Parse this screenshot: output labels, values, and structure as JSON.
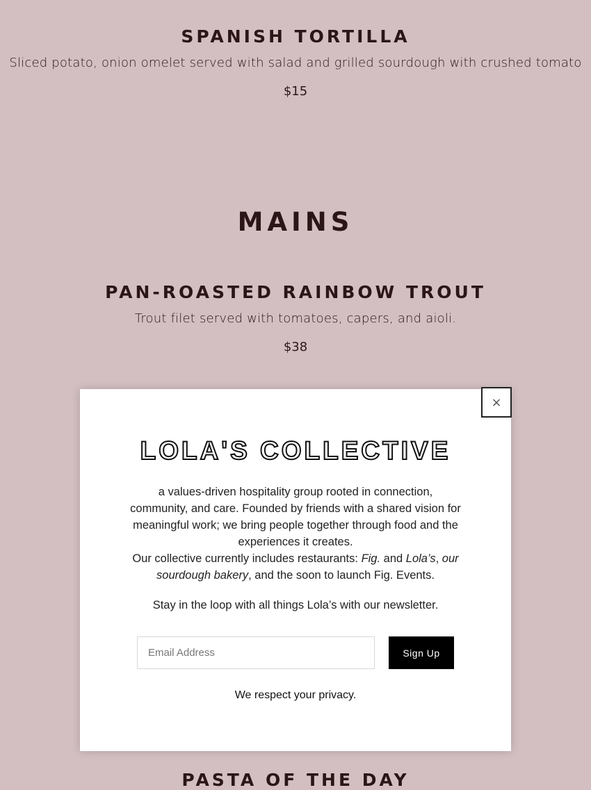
{
  "menu": {
    "dish1": {
      "name": "SPANISH TORTILLA",
      "description": "Sliced potato, onion omelet served with salad and grilled sourdough with crushed tomato",
      "price": "$15"
    },
    "section": {
      "title": "MAINS"
    },
    "dish2": {
      "name": "PAN-ROASTED RAINBOW TROUT",
      "description": "Trout filet served with tomatoes, capers, and aioli.",
      "price": "$38"
    },
    "dish3": {
      "name": "PASTA OF THE DAY"
    }
  },
  "modal": {
    "close_label": "×",
    "brand": "LOLA'S COLLECTIVE",
    "blurb_line1": "a values-driven hospitality group rooted in connection, community, and care. Founded by friends with a shared vision for meaningful work; we bring people together through food and the experiences it creates.",
    "blurb_line2_prefix": "Our collective currently includes restaurants: ",
    "blurb_fig": "Fig.",
    "blurb_and": " and ",
    "blurb_lolas": "Lola’s",
    "blurb_comma": ", ",
    "blurb_bakery": "our sourdough bakery",
    "blurb_suffix": ", and the soon to launch Fig. Events.",
    "newsletter_text": "Stay in the loop with all things Lola’s with our newsletter.",
    "email_placeholder": "Email Address",
    "signup_label": "Sign Up",
    "privacy_text": "We respect your privacy."
  },
  "colors": {
    "background": "#d3bfc1",
    "text_dark": "#2b1517",
    "button": "#000000"
  }
}
